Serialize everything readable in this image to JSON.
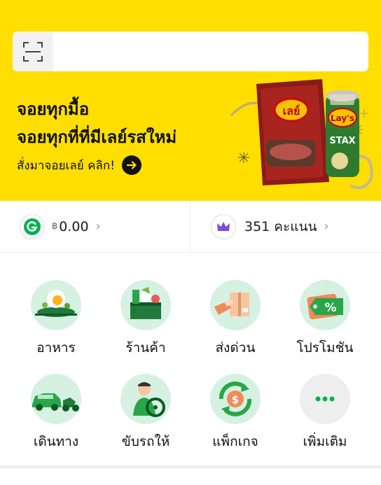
{
  "search": {
    "placeholder": ""
  },
  "banner": {
    "line1": "จอยทุกมื้อ",
    "line2": "จอยทุกที่ที่มีเลย์รสใหม่",
    "cta": "สั่งมาจอยเลย์ คลิก!",
    "brand_left": "เลย์",
    "brand_right": "Lay's",
    "product_name": "STAX"
  },
  "wallet": {
    "currency_symbol": "฿",
    "balance": "0.00",
    "points": "351 คะแนน"
  },
  "services": [
    {
      "label": "อาหาร",
      "icon": "food-icon"
    },
    {
      "label": "ร้านค้า",
      "icon": "mart-icon"
    },
    {
      "label": "ส่งด่วน",
      "icon": "express-icon"
    },
    {
      "label": "โปรโมชัน",
      "icon": "promo-icon"
    },
    {
      "label": "เดินทาง",
      "icon": "transport-icon"
    },
    {
      "label": "ขับรถให้",
      "icon": "driver-icon"
    },
    {
      "label": "แพ็กเกจ",
      "icon": "package-icon"
    },
    {
      "label": "เพิ่มเติม",
      "icon": "more-icon"
    }
  ],
  "colors": {
    "banner_bg": "#ffde00",
    "brand_green": "#00b14f",
    "icon_bg": "#d6f1e1",
    "points_purple": "#7c4dd8"
  }
}
